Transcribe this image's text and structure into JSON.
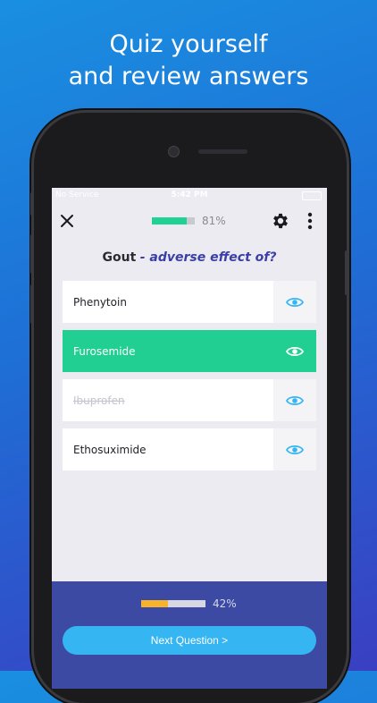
{
  "headline": {
    "line1": "Quiz yourself",
    "line2": "and review answers"
  },
  "status_bar": {
    "carrier": "No Service",
    "time": "5:42 PM"
  },
  "top_bar": {
    "close_icon": "close-icon",
    "settings_icon": "gear-icon",
    "more_icon": "more-vertical-icon",
    "progress": {
      "value": 0.81,
      "label": "81%"
    }
  },
  "question": {
    "subject": "Gout",
    "prompt": "- adverse effect of?"
  },
  "answers": [
    {
      "label": "Phenytoin",
      "state": "default"
    },
    {
      "label": "Furosemide",
      "state": "correct"
    },
    {
      "label": "Ibuprofen",
      "state": "eliminated"
    },
    {
      "label": "Ethosuximide",
      "state": "default"
    }
  ],
  "footer": {
    "progress": {
      "value": 0.42,
      "label": "42%"
    },
    "next_button_label": "Next Question >"
  },
  "colors": {
    "correct": "#22cf93",
    "accent": "#35b6f3",
    "footer_bg": "#3c4aa3",
    "footer_fill": "#f7b32b",
    "eye_icon": "#35b6f3"
  }
}
